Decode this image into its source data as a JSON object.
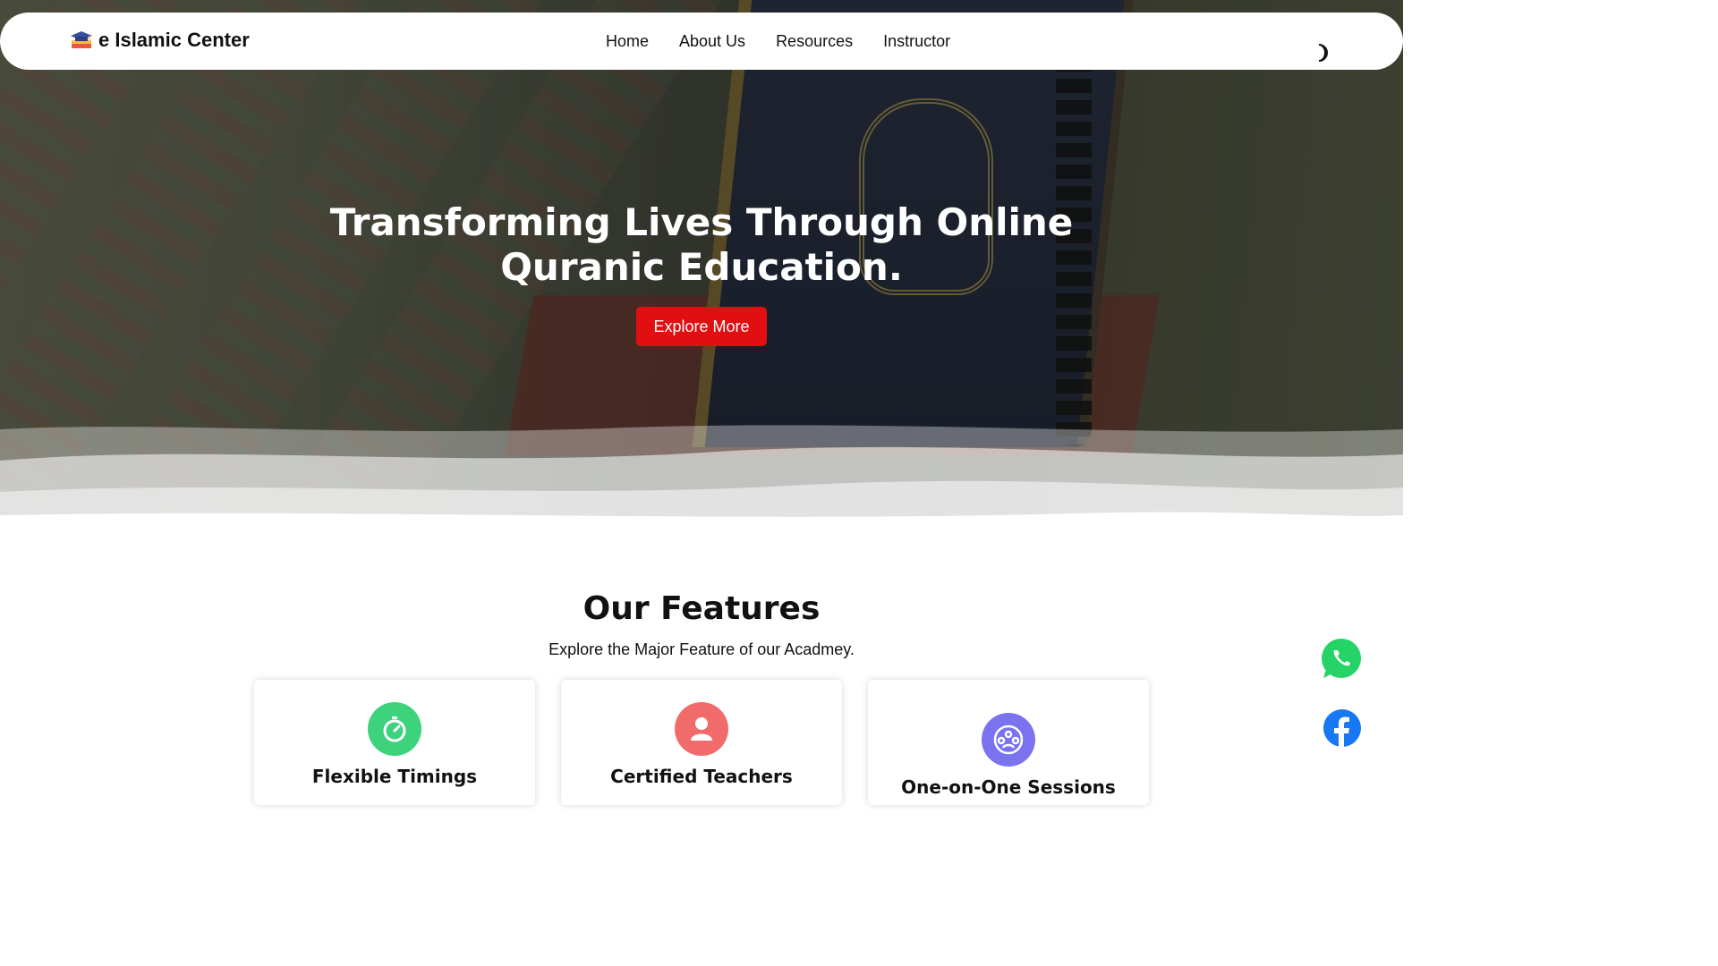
{
  "header": {
    "logo_text": "e Islamic Center",
    "nav": [
      {
        "label": "Home"
      },
      {
        "label": "About Us"
      },
      {
        "label": "Resources"
      },
      {
        "label": "Instructor"
      }
    ],
    "theme_toggle_icon": "moon-icon"
  },
  "hero": {
    "title": "Transforming Lives Through Online Quranic Education.",
    "cta_label": "Explore More"
  },
  "features": {
    "title": "Our Features",
    "subtitle": "Explore the Major Feature of our Acadmey.",
    "cards": [
      {
        "title": "Flexible Timings",
        "icon": "stopwatch-icon",
        "color": "#3dd37d"
      },
      {
        "title": "Certified Teachers",
        "icon": "teacher-icon",
        "color": "#f26b6b"
      },
      {
        "title": "One-on-One Sessions",
        "icon": "group-session-icon",
        "color": "#7b72f0"
      }
    ]
  },
  "floating": {
    "whatsapp_icon": "whatsapp-icon",
    "facebook_icon": "facebook-icon"
  },
  "colors": {
    "cta": "#e10f12",
    "whatsapp": "#25d366",
    "facebook": "#1877f2"
  }
}
